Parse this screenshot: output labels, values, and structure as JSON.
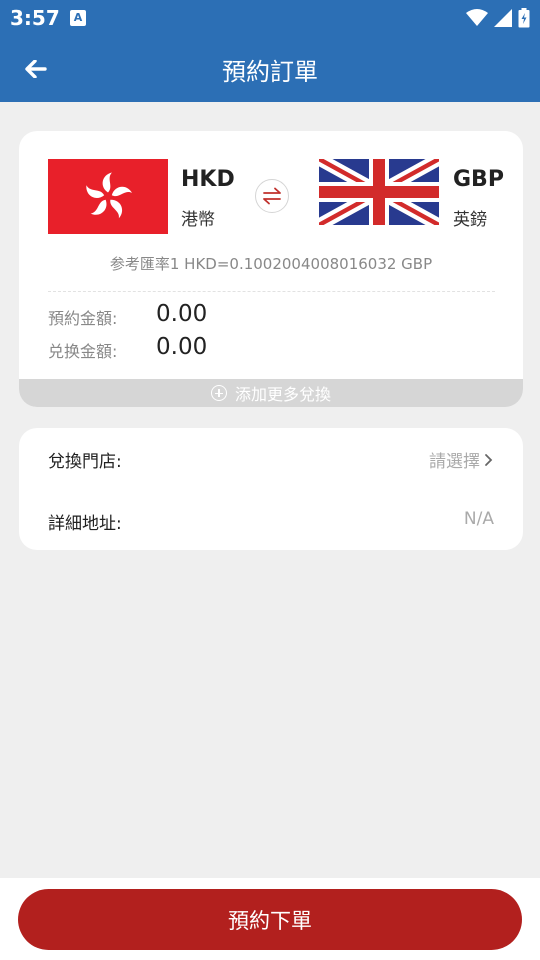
{
  "status_bar": {
    "time": "3:57",
    "app_icon_letter": "A",
    "icons": [
      "wifi-icon",
      "cell-signal-icon",
      "battery-icon"
    ]
  },
  "app_bar": {
    "title": "預約訂單",
    "back_icon": "back-arrow-icon"
  },
  "exchange": {
    "from": {
      "code": "HKD",
      "name": "港幣",
      "flag": "hong-kong-flag"
    },
    "to": {
      "code": "GBP",
      "name": "英鎊",
      "flag": "uk-flag"
    },
    "swap_icon": "swap-arrows-icon",
    "rate_text": "参考匯率1 HKD=0.1002004008016032 GBP",
    "reserve_amount_label": "預約金額:",
    "reserve_amount_value": "0.00",
    "exchange_amount_label": "兑换金額:",
    "exchange_amount_value": "0.00",
    "add_more_label": "添加更多兌換"
  },
  "store": {
    "store_label": "兌換門店:",
    "store_value": "請選擇",
    "address_label": "詳細地址:",
    "address_value": "N/A"
  },
  "footer": {
    "submit_label": "預約下單"
  },
  "colors": {
    "primary_blue": "#2c6fb5",
    "submit_red": "#b2201e",
    "background": "#efefef"
  }
}
